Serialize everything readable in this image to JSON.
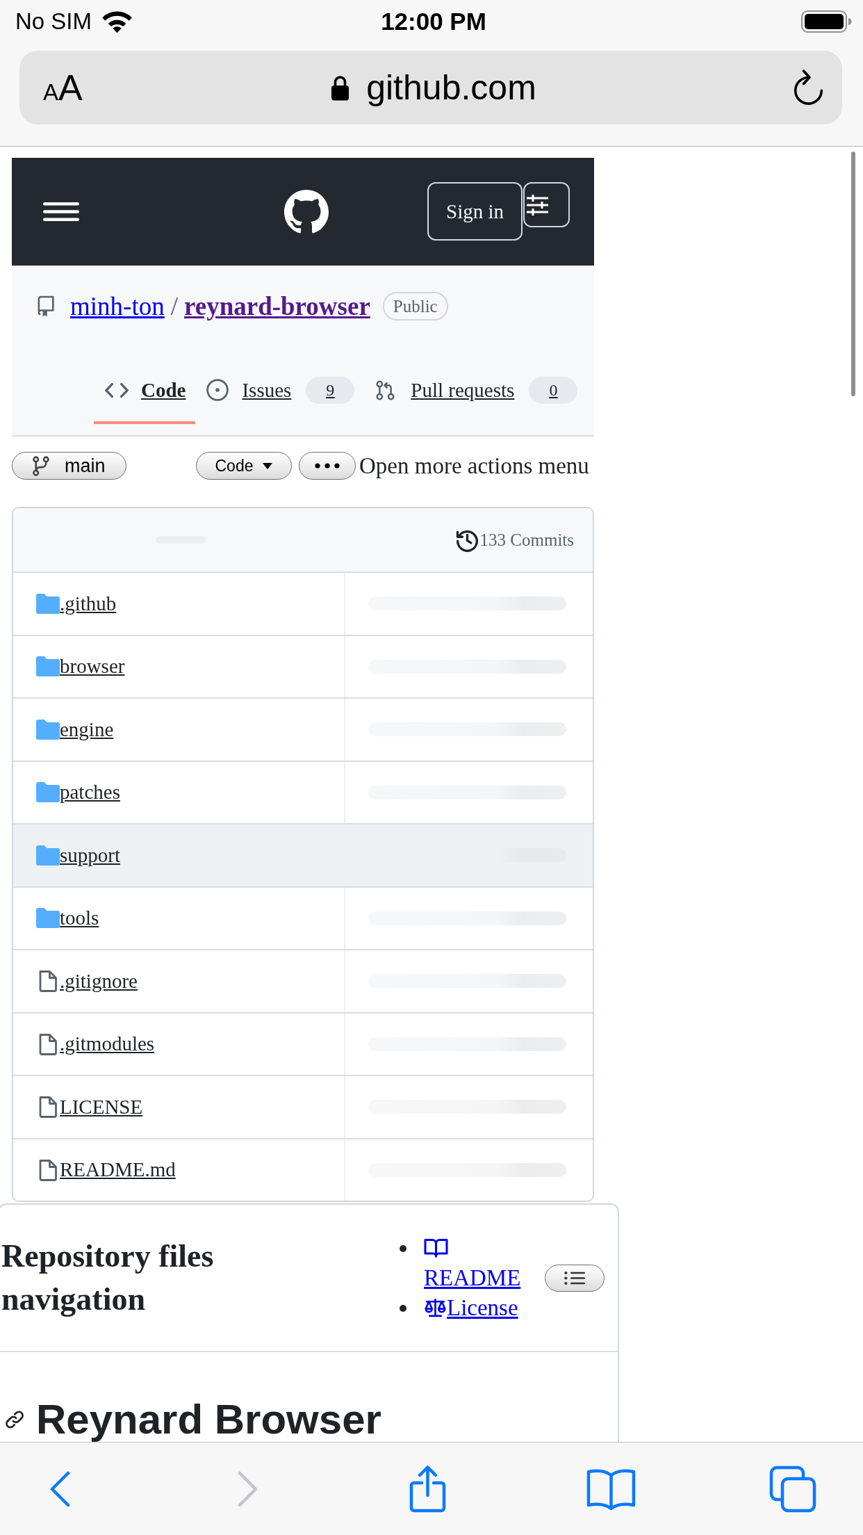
{
  "status_bar": {
    "carrier": "No SIM",
    "time": "12:00 PM"
  },
  "address_bar": {
    "text_size": "AA",
    "url": "github.com"
  },
  "site_header": {
    "sign_in": "Sign in"
  },
  "repo": {
    "owner": "minh-ton",
    "separator": "/",
    "name": "reynard-browser",
    "visibility": "Public"
  },
  "tabs": [
    {
      "kind": "code",
      "label": "Code",
      "selected": true
    },
    {
      "kind": "issues",
      "label": "Issues",
      "count": "9",
      "selected": false
    },
    {
      "kind": "pulls",
      "label": "Pull requests",
      "count": "0",
      "selected": false
    }
  ],
  "actions": {
    "branch": "main",
    "code_button": "Code",
    "more_label": "Open more actions menu"
  },
  "files": {
    "commits": "133 Commits",
    "rows": [
      {
        "kind": "folder",
        "name": ".github",
        "highlighted": false
      },
      {
        "kind": "folder",
        "name": "browser",
        "highlighted": false
      },
      {
        "kind": "folder",
        "name": "engine",
        "highlighted": false
      },
      {
        "kind": "folder",
        "name": "patches",
        "highlighted": false
      },
      {
        "kind": "folder",
        "name": "support",
        "highlighted": true
      },
      {
        "kind": "folder",
        "name": "tools",
        "highlighted": false
      },
      {
        "kind": "file",
        "name": ".gitignore",
        "highlighted": false
      },
      {
        "kind": "file",
        "name": ".gitmodules",
        "highlighted": false
      },
      {
        "kind": "file",
        "name": "LICENSE",
        "highlighted": false
      },
      {
        "kind": "file",
        "name": "README.md",
        "highlighted": false
      }
    ]
  },
  "readme_nav": {
    "title": "Repository files navigation",
    "links": [
      {
        "kind": "readme",
        "label": "README"
      },
      {
        "kind": "license",
        "label": "License"
      }
    ]
  },
  "readme": {
    "heading": "Reynard Browser"
  },
  "browser_toolbar": {
    "back_disabled": false,
    "forward_disabled": true
  }
}
